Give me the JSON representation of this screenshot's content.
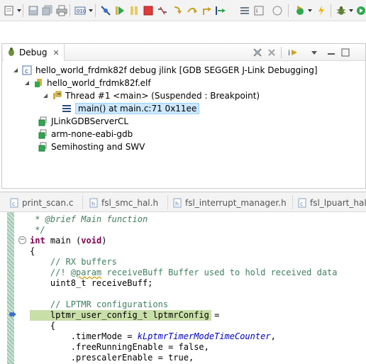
{
  "toolbar": {
    "icons": [
      "new-icon",
      "save-icon",
      "save-all-icon",
      "print-icon",
      "debug-build-icon",
      "skip-breakpoints-icon",
      "resume-icon",
      "suspend-icon",
      "terminate-icon",
      "disconnect-icon",
      "step-into-icon",
      "step-over-icon",
      "step-return-icon",
      "run-to-line-icon",
      "use-step-filters-icon",
      "instruction-stepping-icon",
      "restart-icon",
      "external-tools-icon",
      "debug-icon"
    ]
  },
  "debug_view": {
    "tab_label": "Debug",
    "tree": [
      {
        "label": "hello_world_frdmk82f debug jlink [GDB SEGGER J-Link Debugging]",
        "icon": "launch-config-icon"
      },
      {
        "label": "hello_world_frdmk82f.elf",
        "icon": "debug-target-icon"
      },
      {
        "label": "Thread #1 <main> (Suspended : Breakpoint)",
        "icon": "thread-suspended-icon"
      },
      {
        "label": "main() at main.c:71 0x11ee",
        "icon": "stack-frame-icon"
      },
      {
        "label": "JLinkGDBServerCL",
        "icon": "process-icon"
      },
      {
        "label": "arm-none-eabi-gdb",
        "icon": "process-icon"
      },
      {
        "label": "Semihosting and SWV",
        "icon": "process-icon"
      }
    ]
  },
  "editor": {
    "tabs": [
      "print_scan.c",
      "fsl_smc_hal.h",
      "fsl_interrupt_manager.h",
      "fsl_lpuart_hal.c"
    ],
    "code": {
      "l1": " * @brief Main function",
      "l2": " */",
      "l3_kw": "int",
      "l3_name": " main ",
      "l3_paren_open": "(",
      "l3_void": "void",
      "l3_paren_close": ")",
      "l4": "{",
      "l5": "    // RX buffers",
      "l6_a": "    //! @",
      "l6_param": "param",
      "l6_b": " receiveBuff Buffer used to hold received data",
      "l7": "    uint8_t receiveBuff;",
      "l8": "",
      "l9": "    // LPTMR configurations",
      "l10": "    lptmr_user_config_t lptmrConfig =",
      "l11": "    {",
      "l12_a": "        .timerMode = ",
      "l12_enum": "kLptmrTimerModeTimeCounter",
      "l12_b": ",",
      "l13": "        .freeRunningEnable = false,",
      "l14": "        .prescalerEnable = true,"
    }
  },
  "colors": {
    "comment": "#3f7f5f",
    "keyword": "#7f0055",
    "enum": "#0000c0",
    "current_line": "#c8dfa8",
    "selection": "#cde8ff"
  }
}
